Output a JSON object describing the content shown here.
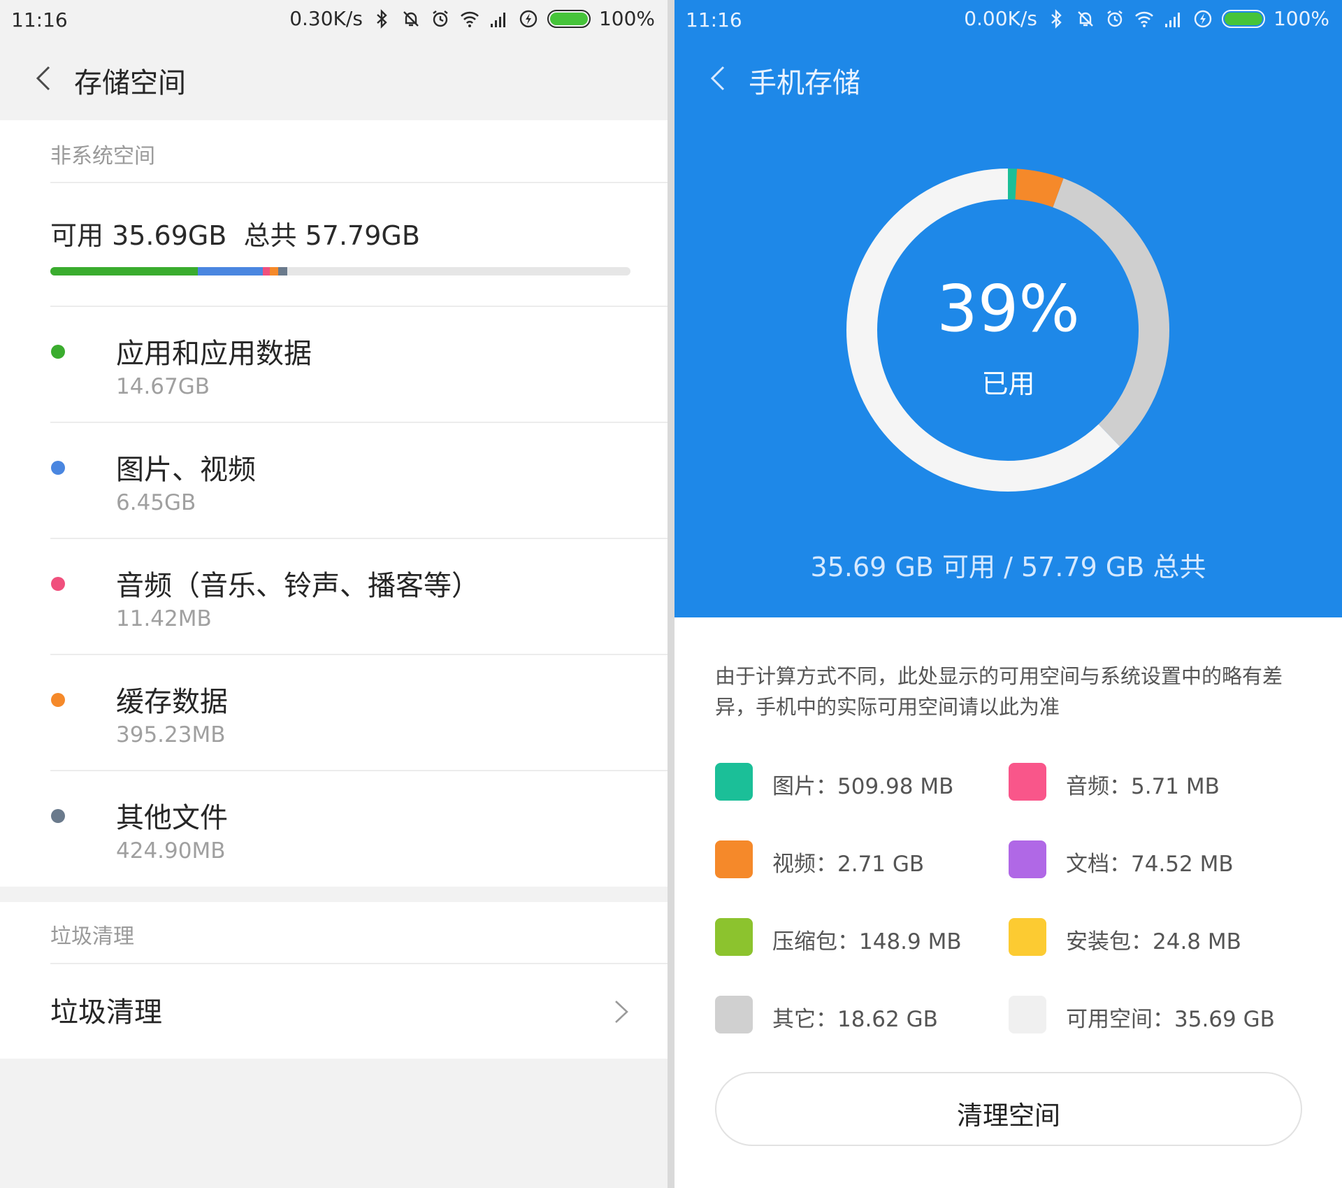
{
  "status_left": {
    "time": "11:16",
    "speed": "0.30K/s",
    "battery": "100%"
  },
  "status_right": {
    "time": "11:16",
    "speed": "0.00K/s",
    "battery": "100%"
  },
  "left": {
    "title": "存储空间",
    "section1_label": "非系统空间",
    "summary": "可用 35.69GB  总共 57.79GB",
    "usage_bar": [
      {
        "color": "#3aac2e",
        "fraction": 0.254
      },
      {
        "color": "#4a86e0",
        "fraction": 0.112
      },
      {
        "color": "#f0507d",
        "fraction": 0.012
      },
      {
        "color": "#f5892a",
        "fraction": 0.015
      },
      {
        "color": "#6a7a8c",
        "fraction": 0.015
      }
    ],
    "categories": [
      {
        "name": "应用和应用数据",
        "size": "14.67GB",
        "color": "#3aac2e"
      },
      {
        "name": "图片、视频",
        "size": "6.45GB",
        "color": "#4a86e0"
      },
      {
        "name": "音频（音乐、铃声、播客等）",
        "size": "11.42MB",
        "color": "#f0507d"
      },
      {
        "name": "缓存数据",
        "size": "395.23MB",
        "color": "#f5892a"
      },
      {
        "name": "其他文件",
        "size": "424.90MB",
        "color": "#6a7a8c"
      }
    ],
    "section2_label": "垃圾清理",
    "junk_item": "垃圾清理"
  },
  "right": {
    "title": "手机存储",
    "percent_used": "39%",
    "used_label": "已用",
    "totals": "35.69 GB 可用 / 57.79 GB 总共",
    "ring": [
      {
        "color": "#1bbf98",
        "fraction": 0.009
      },
      {
        "color": "#f5892a",
        "fraction": 0.047
      },
      {
        "color": "#cfcfcf",
        "fraction": 0.322
      },
      {
        "color": "#f5f5f5",
        "fraction": 0.622
      }
    ],
    "note": "由于计算方式不同，此处显示的可用空间与系统设置中的略有差异，手机中的实际可用空间请以此为准",
    "legend": [
      {
        "label": "图片：509.98 MB",
        "color": "#1bbf98"
      },
      {
        "label": "音频：5.71 MB",
        "color": "#f9568a"
      },
      {
        "label": "视频：2.71 GB",
        "color": "#f5892a"
      },
      {
        "label": "文档：74.52 MB",
        "color": "#b068e6"
      },
      {
        "label": "压缩包：148.9 MB",
        "color": "#8cc32e"
      },
      {
        "label": "安装包：24.8 MB",
        "color": "#fccb32"
      },
      {
        "label": "其它：18.62 GB",
        "color": "#d0d0d0"
      },
      {
        "label": "可用空间：35.69 GB",
        "color": "#f0f0f0"
      }
    ],
    "clean_button": "清理空间"
  },
  "icons": [
    "back-chevron-icon",
    "bluetooth-icon",
    "mute-bell-icon",
    "alarm-icon",
    "wifi-icon",
    "signal-icon",
    "charging-icon",
    "battery-icon",
    "chevron-right-icon"
  ]
}
